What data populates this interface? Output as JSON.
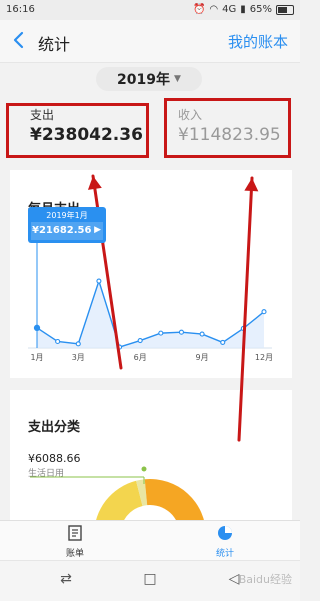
{
  "statusbar": {
    "time": "16:16",
    "network": "4G",
    "battery": "65%"
  },
  "navbar": {
    "title": "统计",
    "right_link": "我的账本"
  },
  "year_selector": {
    "label": "2019年"
  },
  "summary": {
    "expense_label": "支出",
    "expense_value": "¥238042.36",
    "income_label": "收入",
    "income_value": "¥114823.95"
  },
  "monthly_card": {
    "title": "每月支出",
    "tooltip": {
      "month": "2019年1月",
      "amount": "¥21682.56"
    }
  },
  "chart_data": {
    "type": "area",
    "x": [
      1,
      2,
      3,
      4,
      5,
      6,
      7,
      8,
      9,
      10,
      11,
      12
    ],
    "tick_labels": [
      "1月",
      "3月",
      "6月",
      "9月",
      "12月"
    ],
    "tick_positions": [
      1,
      3,
      6,
      9,
      12
    ],
    "series": [
      {
        "values": [
          21682.56,
          7000,
          4500,
          72000,
          1000,
          8000,
          16000,
          17000,
          15000,
          6000,
          21000,
          39000
        ]
      }
    ],
    "ylim": [
      0,
      100000
    ],
    "grid": false,
    "selected_index": 0,
    "colors": {
      "line": "#2a90f0",
      "fill": "#dbeafc"
    }
  },
  "category_card": {
    "title": "支出分类",
    "top_item": {
      "amount": "¥6088.66",
      "name": "生活日用"
    },
    "colors": {
      "main": "#f5a623",
      "secondary": "#f3d54e",
      "light": "#e9e6a3",
      "marker": "#8bc34a"
    }
  },
  "bottom_tabs": [
    {
      "label": "账单",
      "icon": "bill-icon",
      "active": false
    },
    {
      "label": "统计",
      "icon": "pie-chart-icon",
      "active": true
    }
  ],
  "watermark": "Baidu经验",
  "colors": {
    "accent": "#2b8ff0",
    "annotation_red": "#c81717"
  }
}
